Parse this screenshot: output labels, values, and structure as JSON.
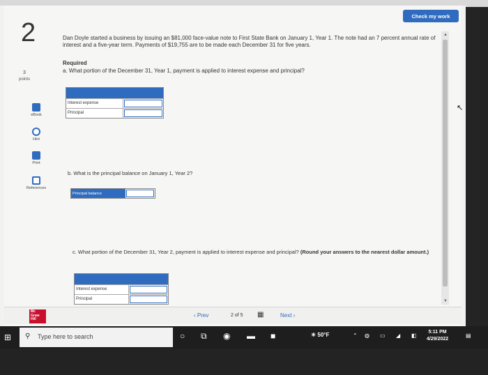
{
  "header": {
    "check_label": "Check my work"
  },
  "question": {
    "number": "2",
    "points_value": "3",
    "points_label": "points"
  },
  "sidebar": {
    "items": [
      {
        "label": "eBook"
      },
      {
        "label": "Hint"
      },
      {
        "label": "Print"
      },
      {
        "label": "References"
      }
    ]
  },
  "problem": {
    "text": "Dan Doyle started a business by issuing an $81,000 face-value note to First State Bank on January 1, Year 1. The note had an 7 percent annual rate of interest and a five-year term. Payments of $19,755 are to be made each December 31 for five years.",
    "required_label": "Required",
    "part_a": "a. What portion of the December 31, Year 1, payment is applied to interest expense and principal?",
    "part_b": "b. What is the principal balance on January 1, Year 2?",
    "part_c_text": "c. What portion of the December 31, Year 2, payment is applied to interest expense and principal?",
    "part_c_note": "(Round your answers to the nearest dollar amount.)"
  },
  "table_a": {
    "rows": [
      {
        "label": "Interest expense",
        "value": ""
      },
      {
        "label": "Principal",
        "value": ""
      }
    ]
  },
  "table_b": {
    "label": "Principal balance",
    "value": ""
  },
  "table_c": {
    "rows": [
      {
        "label": "Interest expense",
        "value": ""
      },
      {
        "label": "Principal",
        "value": ""
      }
    ]
  },
  "nav": {
    "logo_text": "Mc Graw Hill",
    "prev_label": "Prev",
    "page_current": "2",
    "page_of": "of",
    "page_total": "5",
    "next_label": "Next"
  },
  "taskbar": {
    "search_placeholder": "Type here to search",
    "temperature": "50°F",
    "time": "5:11 PM",
    "date": "4/29/2022"
  },
  "colors": {
    "accent": "#2f6bbf",
    "logo": "#c8102e",
    "taskbar": "#1e1e1e"
  }
}
